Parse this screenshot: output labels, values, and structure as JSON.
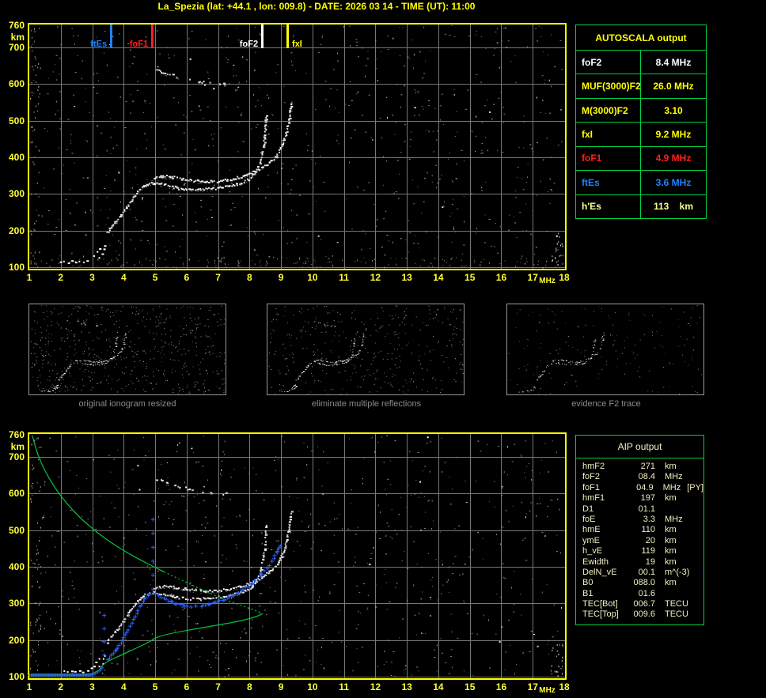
{
  "title": "La_Spezia (lat: +44.1 , lon: 009.8) - DATE: 2026 03 14 - TIME (UT): 11:00",
  "colors": {
    "background": "#000000",
    "accent_yellow": "#ffff00",
    "tick_yellow": "#ffff30",
    "grid_gray": "#777777",
    "table_border_green": "#00d042",
    "trace_white": "#ffffff",
    "fitted_blue": "#2e62ff",
    "profile_green": "#00c43c",
    "marker_blue": "#1e82ff",
    "marker_red": "#ff2020",
    "pale_yellow": "#ffff90",
    "aip_text": "#efefc4",
    "caption_gray": "#8c8c8c"
  },
  "autoscala": {
    "title": "AUTOSCALA output",
    "rows": [
      {
        "label": "foF2",
        "value": "8.4 MHz",
        "color": "#ffffff"
      },
      {
        "label": "MUF(3000)F2",
        "value": "26.0 MHz",
        "color": "#ffff00"
      },
      {
        "label": "M(3000)F2",
        "value": "3.10",
        "color": "#ffff00"
      },
      {
        "label": "fxI",
        "value": "9.2 MHz",
        "color": "#ffff00"
      },
      {
        "label": "foF1",
        "value": "4.9 MHz",
        "color": "#ff2020"
      },
      {
        "label": "ftEs",
        "value": "3.6 MHz",
        "color": "#1e82ff"
      },
      {
        "label": "h'Es",
        "value": "113    km",
        "color": "#ffff90"
      }
    ]
  },
  "aip": {
    "title": "AIP output",
    "rows": [
      {
        "name": "hmF2",
        "value": "271",
        "unit": "km",
        "extra": ""
      },
      {
        "name": "foF2",
        "value": "08.4",
        "unit": "MHz",
        "extra": ""
      },
      {
        "name": "foF1",
        "value": "04.9",
        "unit": "MHz",
        "extra": "[PY]"
      },
      {
        "name": "hmF1",
        "value": "197",
        "unit": "km",
        "extra": ""
      },
      {
        "name": "D1",
        "value": "01.1",
        "unit": "",
        "extra": ""
      },
      {
        "name": "foE",
        "value": "3.3",
        "unit": "MHz",
        "extra": ""
      },
      {
        "name": "hmE",
        "value": "110",
        "unit": "km",
        "extra": ""
      },
      {
        "name": "ymE",
        "value": "20",
        "unit": "km",
        "extra": ""
      },
      {
        "name": "h_vE",
        "value": "119",
        "unit": "km",
        "extra": ""
      },
      {
        "name": "Ewidth",
        "value": "19",
        "unit": "km",
        "extra": ""
      },
      {
        "name": "DelN_vE",
        "value": "00.1",
        "unit": "m^(-3)",
        "extra": ""
      },
      {
        "name": "B0",
        "value": "088.0",
        "unit": "km",
        "extra": ""
      },
      {
        "name": "B1",
        "value": "01.6",
        "unit": "",
        "extra": ""
      },
      {
        "name": "TEC[Bot]",
        "value": "006.7",
        "unit": "TECU",
        "extra": ""
      },
      {
        "name": "TEC[Top]",
        "value": "009.6",
        "unit": "TECU",
        "extra": ""
      }
    ]
  },
  "thumbnails": [
    {
      "caption": "original ionogram resized"
    },
    {
      "caption": "eliminate multiple reflections"
    },
    {
      "caption": "evidence F2 trace"
    }
  ],
  "chart_data": [
    {
      "type": "scatter",
      "name": "autoscaled ionogram",
      "xlabel": "MHz",
      "ylabel": "km",
      "xlim": [
        1,
        18
      ],
      "ylim": [
        100,
        760
      ],
      "xticks": [
        1,
        2,
        3,
        4,
        5,
        6,
        7,
        8,
        9,
        10,
        11,
        12,
        13,
        14,
        15,
        16,
        17,
        18
      ],
      "yticks": [
        760,
        700,
        600,
        500,
        400,
        300,
        200,
        100
      ],
      "grid": true,
      "markers": [
        {
          "label": "ftEs",
          "freq": 3.6,
          "color": "#1e82ff",
          "side": "left"
        },
        {
          "label": "foF1",
          "freq": 4.9,
          "color": "#ff2020",
          "side": "left"
        },
        {
          "label": "foF2",
          "freq": 8.4,
          "color": "#ffffff",
          "side": "left"
        },
        {
          "label": "fxI",
          "freq": 9.2,
          "color": "#ffff00",
          "side": "right"
        }
      ],
      "series": {
        "o_trace": [
          [
            3.45,
            195
          ],
          [
            3.55,
            205
          ],
          [
            3.65,
            216
          ],
          [
            3.75,
            227
          ],
          [
            3.85,
            238
          ],
          [
            3.95,
            250
          ],
          [
            4.05,
            262
          ],
          [
            4.15,
            274
          ],
          [
            4.25,
            287
          ],
          [
            4.35,
            299
          ],
          [
            4.45,
            310
          ],
          [
            4.55,
            319
          ],
          [
            4.67,
            326
          ],
          [
            4.8,
            330
          ],
          [
            4.95,
            331
          ],
          [
            5.1,
            330
          ],
          [
            5.3,
            326
          ],
          [
            5.5,
            321
          ],
          [
            5.7,
            318
          ],
          [
            5.9,
            315
          ],
          [
            6.1,
            314
          ],
          [
            6.3,
            313
          ],
          [
            6.5,
            314
          ],
          [
            6.7,
            315
          ],
          [
            6.9,
            317
          ],
          [
            7.1,
            319
          ],
          [
            7.3,
            322
          ],
          [
            7.5,
            326
          ],
          [
            7.7,
            331
          ],
          [
            7.85,
            337
          ],
          [
            8.0,
            344
          ],
          [
            8.1,
            352
          ],
          [
            8.2,
            363
          ],
          [
            8.28,
            377
          ],
          [
            8.35,
            394
          ],
          [
            8.4,
            415
          ],
          [
            8.44,
            440
          ],
          [
            8.47,
            468
          ],
          [
            8.49,
            495
          ],
          [
            8.5,
            515
          ]
        ],
        "x_trace": [
          [
            4.95,
            344
          ],
          [
            5.15,
            348
          ],
          [
            5.35,
            349
          ],
          [
            5.55,
            347
          ],
          [
            5.75,
            344
          ],
          [
            5.95,
            341
          ],
          [
            6.15,
            338
          ],
          [
            6.35,
            336
          ],
          [
            6.55,
            335
          ],
          [
            6.75,
            335
          ],
          [
            6.95,
            336
          ],
          [
            7.15,
            338
          ],
          [
            7.35,
            341
          ],
          [
            7.55,
            345
          ],
          [
            7.75,
            350
          ],
          [
            7.95,
            356
          ],
          [
            8.15,
            363
          ],
          [
            8.35,
            372
          ],
          [
            8.55,
            383
          ],
          [
            8.7,
            394
          ],
          [
            8.85,
            408
          ],
          [
            8.95,
            423
          ],
          [
            9.05,
            441
          ],
          [
            9.13,
            462
          ],
          [
            9.19,
            486
          ],
          [
            9.24,
            510
          ],
          [
            9.28,
            532
          ],
          [
            9.3,
            550
          ]
        ],
        "second_hop": [
          [
            5.05,
            641
          ],
          [
            5.25,
            633
          ],
          [
            5.45,
            627
          ],
          [
            5.7,
            621
          ],
          [
            5.95,
            616
          ],
          [
            6.2,
            611
          ],
          [
            6.5,
            607
          ],
          [
            6.8,
            604
          ],
          [
            7.05,
            601
          ],
          [
            7.25,
            600
          ]
        ],
        "es_trace": [
          [
            1.95,
            114
          ],
          [
            2.08,
            117
          ],
          [
            2.2,
            113
          ],
          [
            2.32,
            117
          ],
          [
            2.45,
            114
          ],
          [
            2.58,
            118
          ],
          [
            2.7,
            115
          ],
          [
            2.82,
            119
          ],
          [
            2.95,
            123
          ],
          [
            3.05,
            131
          ],
          [
            3.12,
            142
          ],
          [
            3.2,
            151
          ],
          [
            3.28,
            156
          ],
          [
            3.35,
            149
          ],
          [
            3.3,
            138
          ],
          [
            3.22,
            128
          ],
          [
            3.38,
            160
          ]
        ]
      }
    },
    {
      "type": "scatter",
      "name": "adjusted ionogram with AIP profile",
      "xlabel": "MHz",
      "ylabel": "km",
      "xlim": [
        1,
        18
      ],
      "ylim": [
        100,
        760
      ],
      "xticks": [
        1,
        2,
        3,
        4,
        5,
        6,
        7,
        8,
        9,
        10,
        11,
        12,
        13,
        14,
        15,
        16,
        17,
        18
      ],
      "yticks": [
        760,
        700,
        600,
        500,
        400,
        300,
        200,
        100
      ],
      "grid": true,
      "base_series_from": 0,
      "series": {
        "fitted_blue_flat": {
          "from": 1.0,
          "to": 2.95,
          "km": 105,
          "step": 0.055
        },
        "fitted_blue_rise": [
          [
            3.0,
            107
          ],
          [
            3.08,
            110
          ],
          [
            3.16,
            114
          ],
          [
            3.24,
            119
          ],
          [
            3.3,
            125
          ]
        ],
        "fitted_blue_F": [
          [
            3.5,
            148
          ],
          [
            3.6,
            158
          ],
          [
            3.7,
            169
          ],
          [
            3.8,
            180
          ],
          [
            3.9,
            192
          ],
          [
            4.0,
            206
          ],
          [
            4.1,
            221
          ],
          [
            4.2,
            238
          ],
          [
            4.3,
            256
          ],
          [
            4.4,
            274
          ],
          [
            4.5,
            291
          ],
          [
            4.6,
            306
          ],
          [
            4.7,
            317
          ],
          [
            4.82,
            325
          ],
          [
            4.95,
            329
          ],
          [
            5.1,
            323
          ],
          [
            5.25,
            315
          ],
          [
            5.4,
            308
          ],
          [
            5.55,
            303
          ],
          [
            5.7,
            299
          ],
          [
            5.85,
            296
          ],
          [
            6.0,
            294
          ],
          [
            6.15,
            293
          ],
          [
            6.3,
            293
          ],
          [
            6.45,
            294
          ],
          [
            6.6,
            296
          ],
          [
            6.75,
            299
          ],
          [
            6.9,
            303
          ],
          [
            7.05,
            307
          ],
          [
            7.2,
            312
          ],
          [
            7.35,
            318
          ],
          [
            7.5,
            324
          ],
          [
            7.65,
            331
          ],
          [
            7.8,
            339
          ],
          [
            7.95,
            348
          ],
          [
            8.1,
            358
          ],
          [
            8.25,
            369
          ],
          [
            8.4,
            382
          ],
          [
            8.55,
            397
          ],
          [
            8.7,
            414
          ],
          [
            8.8,
            430
          ],
          [
            8.88,
            445
          ],
          [
            8.95,
            458
          ]
        ],
        "blue_asymptote_F1": {
          "freq": 4.92,
          "from": 340,
          "to": 565,
          "step": 38
        },
        "blue_asymptote_E": {
          "freq": 3.37,
          "from": 160,
          "to": 280,
          "step": 36
        },
        "green_topside": [
          [
            1.1,
            758
          ],
          [
            1.14,
            744
          ],
          [
            1.2,
            726
          ],
          [
            1.28,
            705
          ],
          [
            1.38,
            684
          ],
          [
            1.5,
            662
          ],
          [
            1.64,
            640
          ],
          [
            1.8,
            618
          ],
          [
            1.98,
            596
          ],
          [
            2.18,
            574
          ],
          [
            2.4,
            553
          ],
          [
            2.64,
            532
          ],
          [
            2.9,
            512
          ],
          [
            3.18,
            492
          ],
          [
            3.48,
            473
          ],
          [
            3.8,
            455
          ],
          [
            4.14,
            437
          ],
          [
            4.5,
            420
          ],
          [
            4.88,
            403
          ],
          [
            5.28,
            386
          ],
          [
            5.7,
            369
          ],
          [
            6.1,
            353
          ],
          [
            6.5,
            337
          ],
          [
            6.9,
            322
          ],
          [
            7.3,
            308
          ],
          [
            7.65,
            297
          ],
          [
            7.95,
            288
          ],
          [
            8.2,
            280
          ],
          [
            8.35,
            275
          ],
          [
            8.42,
            272
          ]
        ],
        "green_bottomside": [
          [
            8.42,
            272
          ],
          [
            8.3,
            267
          ],
          [
            8.1,
            261
          ],
          [
            7.8,
            254
          ],
          [
            7.4,
            247
          ],
          [
            7.0,
            241
          ],
          [
            6.6,
            235
          ],
          [
            6.2,
            229
          ],
          [
            5.8,
            223
          ],
          [
            5.4,
            216
          ],
          [
            5.1,
            209
          ],
          [
            4.95,
            203
          ],
          [
            4.88,
            198
          ],
          [
            4.7,
            190
          ],
          [
            4.5,
            182
          ],
          [
            4.3,
            174
          ],
          [
            4.1,
            166
          ],
          [
            3.9,
            158
          ],
          [
            3.7,
            150
          ],
          [
            3.5,
            142
          ],
          [
            3.38,
            135
          ],
          [
            3.3,
            128
          ],
          [
            3.26,
            122
          ],
          [
            3.2,
            117
          ],
          [
            3.1,
            112
          ],
          [
            2.98,
            108
          ],
          [
            2.8,
            106
          ],
          [
            2.5,
            106
          ],
          [
            2.1,
            106
          ],
          [
            1.6,
            106
          ],
          [
            1.05,
            106
          ]
        ]
      }
    }
  ]
}
